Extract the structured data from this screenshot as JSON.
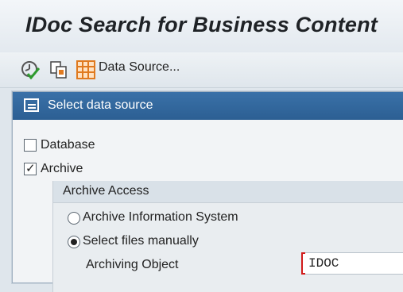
{
  "window": {
    "title": "IDoc Search for Business Content"
  },
  "toolbar": {
    "icons": [
      "execute-icon",
      "copy-objects-icon",
      "table-grid-icon"
    ],
    "data_source_label": "Data Source..."
  },
  "dialog": {
    "title": "Select data source",
    "checkboxes": [
      {
        "label": "Database",
        "checked": false
      },
      {
        "label": "Archive",
        "checked": true
      }
    ],
    "group": {
      "title": "Archive Access",
      "radios": [
        {
          "label": "Archive Information System",
          "selected": false
        },
        {
          "label": "Select files manually",
          "selected": true
        }
      ],
      "field": {
        "label": "Archiving Object",
        "value": "IDOC"
      }
    }
  },
  "colors": {
    "dialog_header": "#2c5f93",
    "required_marker": "#d11a1a",
    "execute_icon_green": "#2e9b2e",
    "grid_icon_orange": "#e07a1f"
  }
}
